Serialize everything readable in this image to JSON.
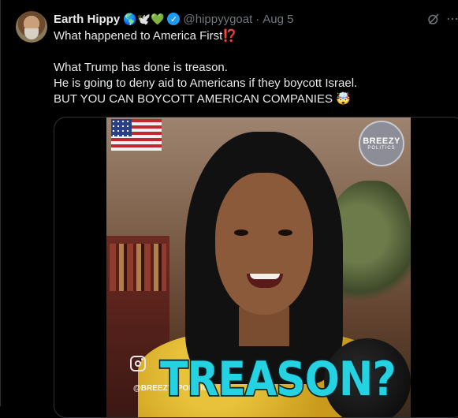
{
  "tweet": {
    "author_name": "Earth Hippy",
    "name_emojis": "🌎🕊️💚",
    "handle": "@hippyygoat",
    "separator": "·",
    "date": "Aug 5",
    "verified": true,
    "lines": [
      "What happened to America First",
      "What Trump has done is treason.",
      "He is going to deny aid to Americans if they boycott Israel.",
      "BUT YOU CAN BOYCOTT AMERICAN COMPANIES"
    ],
    "line1_emoji": "⁉️",
    "line4_emoji": "🤯",
    "more_icon": "more-icon",
    "grok_icon": "grok-icon"
  },
  "media": {
    "caption": "TREASON?",
    "watermark": "@BREEZY_POLITICS",
    "logo_line1": "BREEZY",
    "logo_line2": "POLITICS",
    "flag_icon": "us-flag-icon",
    "instagram_icon": "instagram-icon"
  },
  "colors": {
    "background": "#000000",
    "text": "#e7e9ea",
    "muted": "#71767b",
    "verified": "#1d9bf0",
    "caption": "#24d2e2"
  }
}
